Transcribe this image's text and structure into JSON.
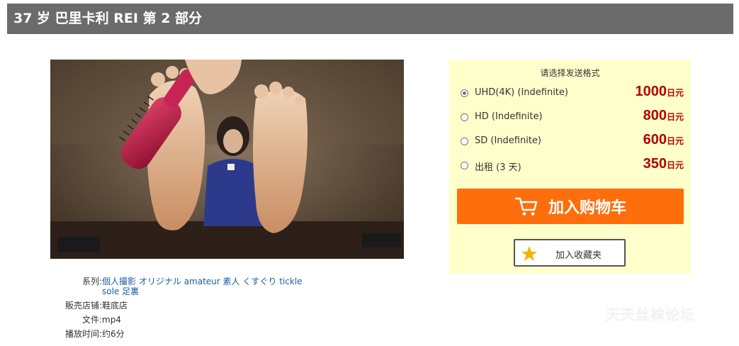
{
  "header": {
    "title": "37 岁 巴里卡利 REI 第 2 部分"
  },
  "preview": {
    "alt": "product-preview-image"
  },
  "info": {
    "series_label": "系列:",
    "series_tags": [
      "個人撮影",
      "オリジナル",
      "amateur",
      "素人",
      "くすぐり",
      "tickle",
      "sole",
      "足裏"
    ],
    "shop_label": "販売店铺:",
    "shop_value": "鞋底店",
    "file_label": "文件:",
    "file_value": "mp4",
    "duration_label": "播放时间:",
    "duration_value": "约6分"
  },
  "purchase": {
    "format_title": "请选择发送格式",
    "currency": "日元",
    "options": [
      {
        "label": "UHD(4K) (Indefinite)",
        "price": "1000",
        "selected": true
      },
      {
        "label": "HD (Indefinite)",
        "price": "800",
        "selected": false
      },
      {
        "label": "SD (Indefinite)",
        "price": "600",
        "selected": false
      },
      {
        "label": "出租 (3 天)",
        "price": "350",
        "selected": false
      }
    ],
    "cart_button": "加入购物车",
    "favorite_button": "加入收藏夹",
    "accent_color": "#ff6e0c",
    "price_color": "#b40000"
  },
  "watermark": "天天丝袜论坛"
}
